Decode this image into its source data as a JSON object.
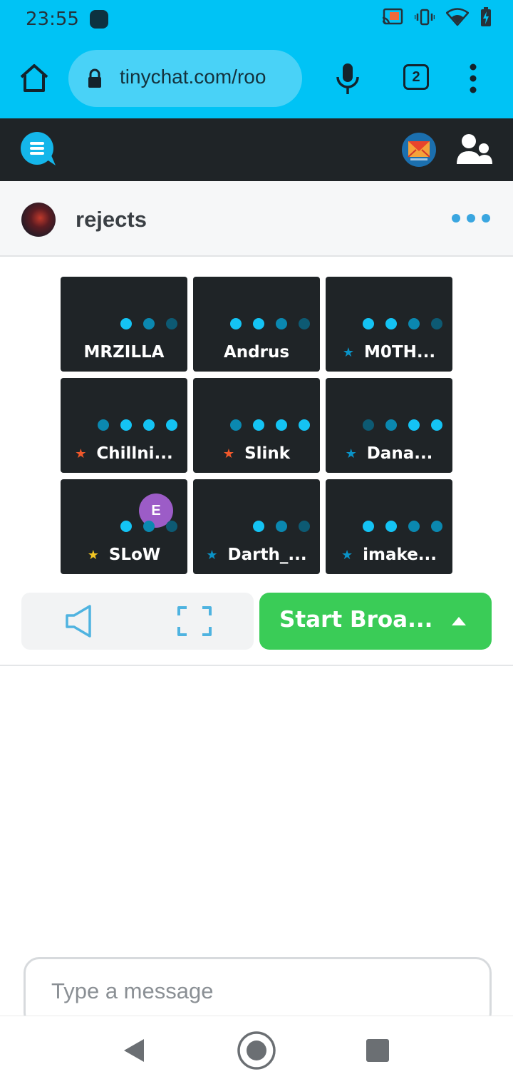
{
  "status_bar": {
    "time": "23:55",
    "icons": [
      "notification-dot-icon",
      "cast-icon",
      "vibrate-icon",
      "wifi-icon",
      "battery-charging-icon"
    ]
  },
  "browser": {
    "url": "tinychat.com/roo",
    "tab_count": "2",
    "icons": [
      "home-icon",
      "lock-icon",
      "mic-icon",
      "tabs-icon",
      "menu-icon"
    ]
  },
  "app_header": {
    "icons": [
      "chat-logo-icon",
      "profile-avatar",
      "users-icon"
    ]
  },
  "room": {
    "name": "rejects"
  },
  "tiles": [
    {
      "name": "MRZILLA",
      "star": "",
      "dots": [
        "bright",
        "mid",
        "dim"
      ]
    },
    {
      "name": "Andrus",
      "star": "",
      "dots": [
        "bright",
        "bright",
        "mid",
        "dim"
      ]
    },
    {
      "name": "M0TH...",
      "star": "blue",
      "dots": [
        "bright",
        "bright",
        "mid",
        "dim"
      ]
    },
    {
      "name": "Chillni...",
      "star": "orange",
      "dots": [
        "mid",
        "bright",
        "bright",
        "bright"
      ]
    },
    {
      "name": "Slink",
      "star": "orange",
      "dots": [
        "mid",
        "bright",
        "bright",
        "bright"
      ]
    },
    {
      "name": "Dana...",
      "star": "blue",
      "dots": [
        "dim",
        "mid",
        "bright",
        "bright"
      ]
    },
    {
      "name": "SLoW",
      "star": "gold",
      "dots": [
        "bright",
        "mid",
        "dim"
      ],
      "badge": "E"
    },
    {
      "name": "Darth_...",
      "star": "blue",
      "dots": [
        "bright",
        "mid",
        "dim"
      ]
    },
    {
      "name": "imake...",
      "star": "blue",
      "dots": [
        "bright",
        "bright",
        "mid",
        "mid"
      ]
    }
  ],
  "controls": {
    "broadcast_label": "Start Broa..."
  },
  "chat": {
    "placeholder": "Type a message"
  },
  "colors": {
    "accent": "#00c3f5",
    "dark_bg": "#1f2427",
    "broadcast": "#3acc57",
    "star_orange": "#f0582b",
    "star_blue": "#0a93c7",
    "star_gold": "#f3c623"
  }
}
